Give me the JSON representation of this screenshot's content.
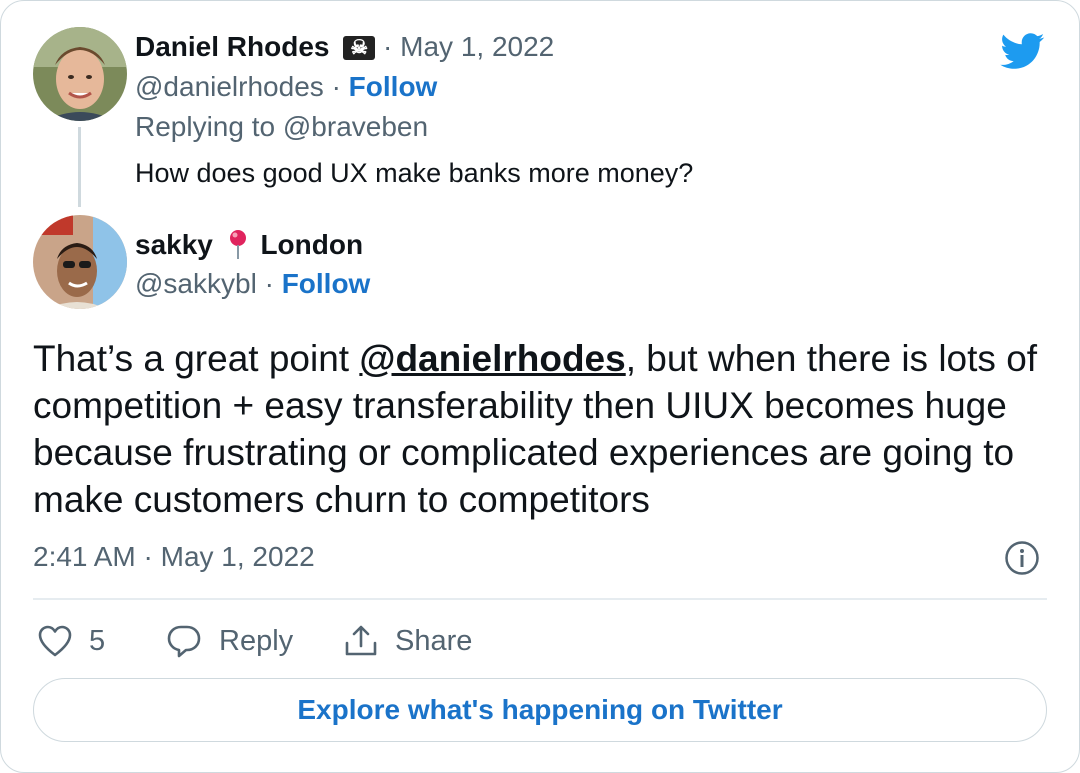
{
  "parent_tweet": {
    "author_name": "Daniel Rhodes",
    "author_emoji": "☠",
    "date": "May 1, 2022",
    "handle": "@danielrhodes",
    "follow_label": "Follow",
    "replying_prefix": "Replying to",
    "replying_to": "@braveben",
    "text": "How does good UX make banks more money?"
  },
  "reply_tweet": {
    "author_name": "sakky",
    "location": "London",
    "handle": "@sakkybl",
    "follow_label": "Follow",
    "text_before_mention": "That’s a great point ",
    "mention": "@danielrhodes",
    "text_after_mention": ", but when there is lots of competition + easy transferability then UIUX becomes huge because frustrating or complicated experiences are going to make customers churn to competitors",
    "timestamp": "2:41 AM · May 1, 2022"
  },
  "actions": {
    "like_count": "5",
    "reply_label": "Reply",
    "share_label": "Share"
  },
  "explore_label": "Explore what's happening on Twitter",
  "colors": {
    "accent": "#1a73c9",
    "twitter_blue": "#1d9bf0",
    "secondary_text": "#536471",
    "border": "#cfd9de"
  }
}
